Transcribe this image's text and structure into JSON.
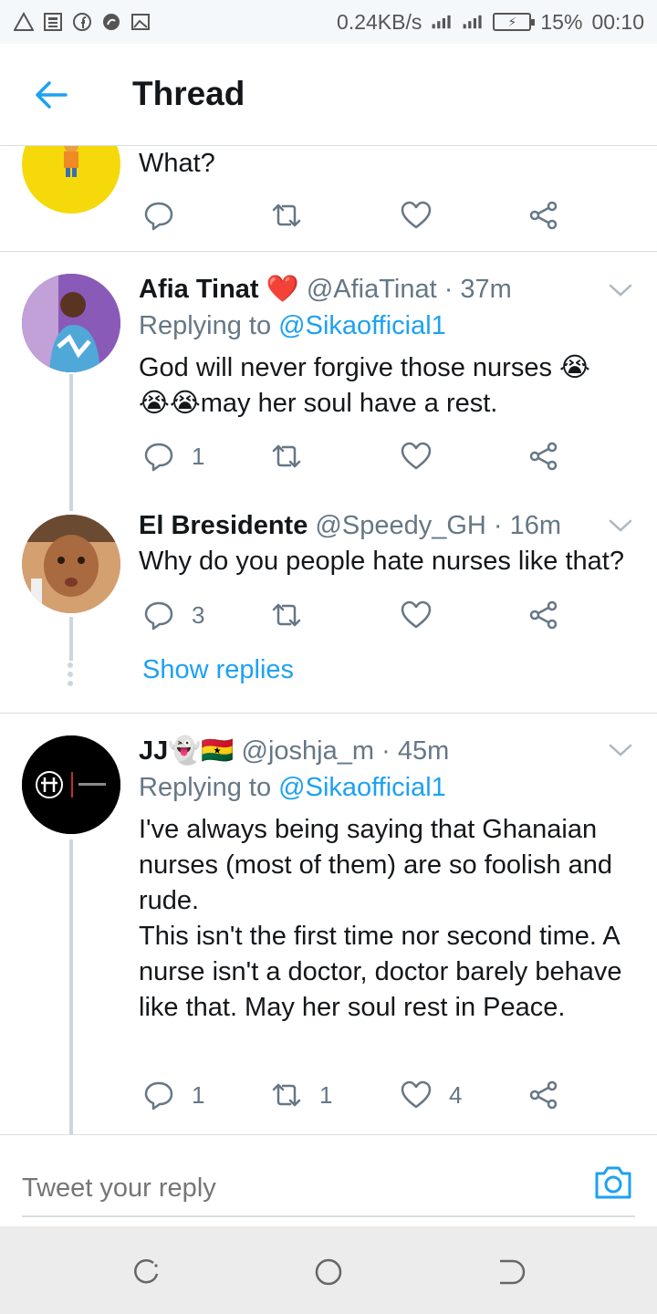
{
  "status_bar": {
    "net_speed": "0.24KB/s",
    "battery_level": "15%",
    "time": "00:10"
  },
  "header": {
    "title": "Thread",
    "back_icon": "arrow-left-icon"
  },
  "tweets": [
    {
      "text": "What?",
      "avatar_color": "#f5d90a"
    },
    {
      "name": "Afia Tinat",
      "name_emoji": "❤️",
      "handle": "@AfiaTinat",
      "time": "· 37m",
      "replying_label": "Replying to",
      "replying_to": "@Sikaofficial1",
      "text": "God will never forgive those nurses 😭\n😭😭may her soul have a rest.",
      "reply_count": "1",
      "retweet_count": "",
      "like_count": ""
    },
    {
      "name": "El Bresidente",
      "handle": "@Speedy_GH",
      "time": "· 16m",
      "text": "Why do you people hate nurses like that?",
      "reply_count": "3",
      "retweet_count": "",
      "like_count": "",
      "show_replies": "Show replies"
    },
    {
      "name": "JJ",
      "name_emoji": "👻🇬🇭",
      "handle": "@joshja_m",
      "time": "· 45m",
      "replying_label": "Replying to",
      "replying_to": "@Sikaofficial1",
      "text": "I've always being saying that Ghanaian nurses (most of them) are so foolish and rude.\nThis isn't the first time nor second time. A nurse isn't a doctor, doctor barely behave like that. May her soul rest in Peace.",
      "reply_count": "1",
      "retweet_count": "1",
      "like_count": "4"
    }
  ],
  "reply_bar": {
    "placeholder": "Tweet your reply",
    "camera_icon": "camera-icon"
  },
  "colors": {
    "accent": "#1da1f2",
    "secondary_text": "#657786",
    "divider": "#d8dfe4",
    "thread_line": "#ccd6dd"
  }
}
